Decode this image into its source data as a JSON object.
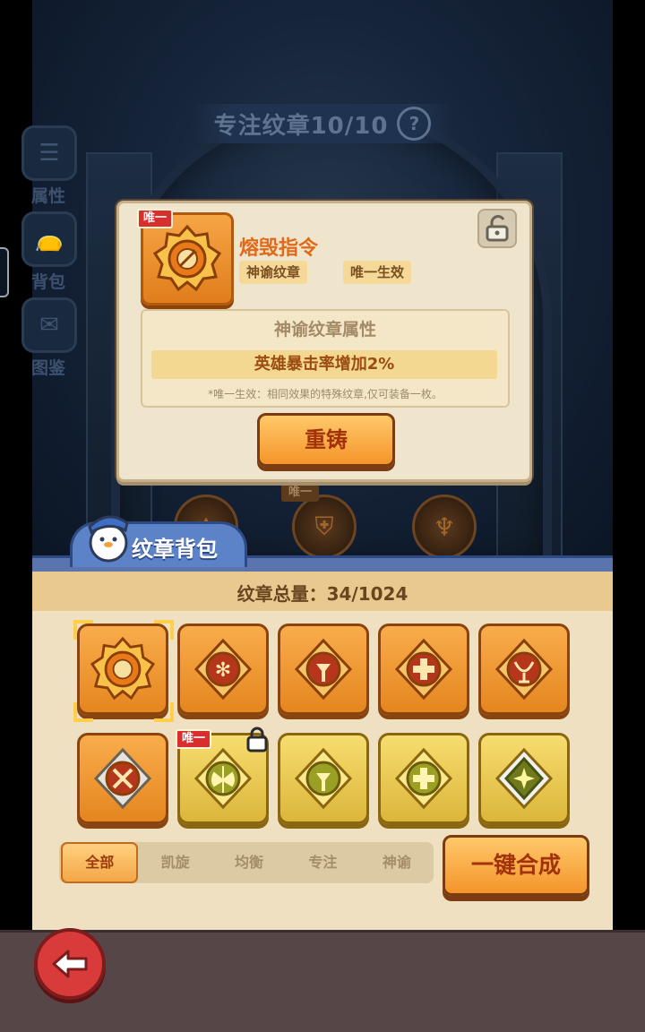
{
  "header": {
    "focus_title": "专注纹章10/10",
    "help_glyph": "?"
  },
  "side_menu": [
    {
      "label": "属性",
      "icon": "list-icon"
    },
    {
      "label": "背包",
      "icon": "bag-icon"
    },
    {
      "label": "图鉴",
      "icon": "album-icon"
    }
  ],
  "slots": {
    "unique_tag": "唯一"
  },
  "popup": {
    "unique_tag": "唯一",
    "name": "熔毁指令",
    "type_chip": "神谕纹章",
    "effect_chip": "唯一生效",
    "attr_title": "神谕纹章属性",
    "attr_line": "英雄暴击率增加2%",
    "attr_note": "*唯一生效：相同效果的特殊纹章,仅可装备一枚。",
    "reforge_label": "重铸",
    "lock_state": "unlocked"
  },
  "bag": {
    "title": "纹章背包",
    "total_label": "纹章总量：34/1024",
    "items": [
      {
        "rarity": "orange",
        "icon": "sword-gear-icon",
        "selected": true
      },
      {
        "rarity": "orange",
        "icon": "snowflake-icon"
      },
      {
        "rarity": "orange",
        "icon": "pillar-icon"
      },
      {
        "rarity": "orange",
        "icon": "cross-icon"
      },
      {
        "rarity": "orange",
        "icon": "chalice-icon"
      },
      {
        "rarity": "orange",
        "icon": "crossed-swords-icon"
      },
      {
        "rarity": "gold",
        "icon": "axe-icon",
        "unique_tag": "唯一",
        "locked": true
      },
      {
        "rarity": "gold",
        "icon": "pillar-icon"
      },
      {
        "rarity": "gold",
        "icon": "cross-icon"
      },
      {
        "rarity": "gold",
        "icon": "star-gem-icon"
      }
    ],
    "filters": [
      "全部",
      "凯旋",
      "均衡",
      "专注",
      "神谕"
    ],
    "active_filter": "全部",
    "merge_label": "一键合成"
  },
  "colors": {
    "accent_orange": "#f4952a",
    "gold": "#dcb63a",
    "unique_red": "#d92e2e"
  }
}
